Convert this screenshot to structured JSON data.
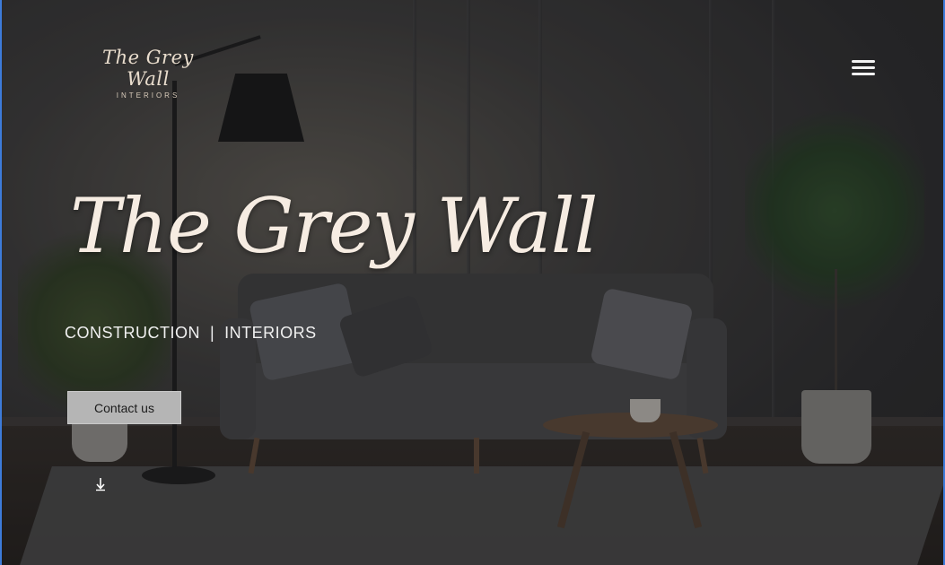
{
  "header": {
    "logo_title": "The Grey Wall",
    "logo_subtitle": "INTERIORS",
    "menu_icon": "hamburger-menu-icon"
  },
  "hero": {
    "title": "The Grey Wall",
    "tagline": "CONSTRUCTION  |  INTERIORS",
    "cta_label": "Contact us",
    "scroll_icon": "arrow-down-icon"
  },
  "colors": {
    "title_text": "#f6ece2",
    "button_bg": "#b5b5b5",
    "frame_accent": "#3d7bd9"
  }
}
